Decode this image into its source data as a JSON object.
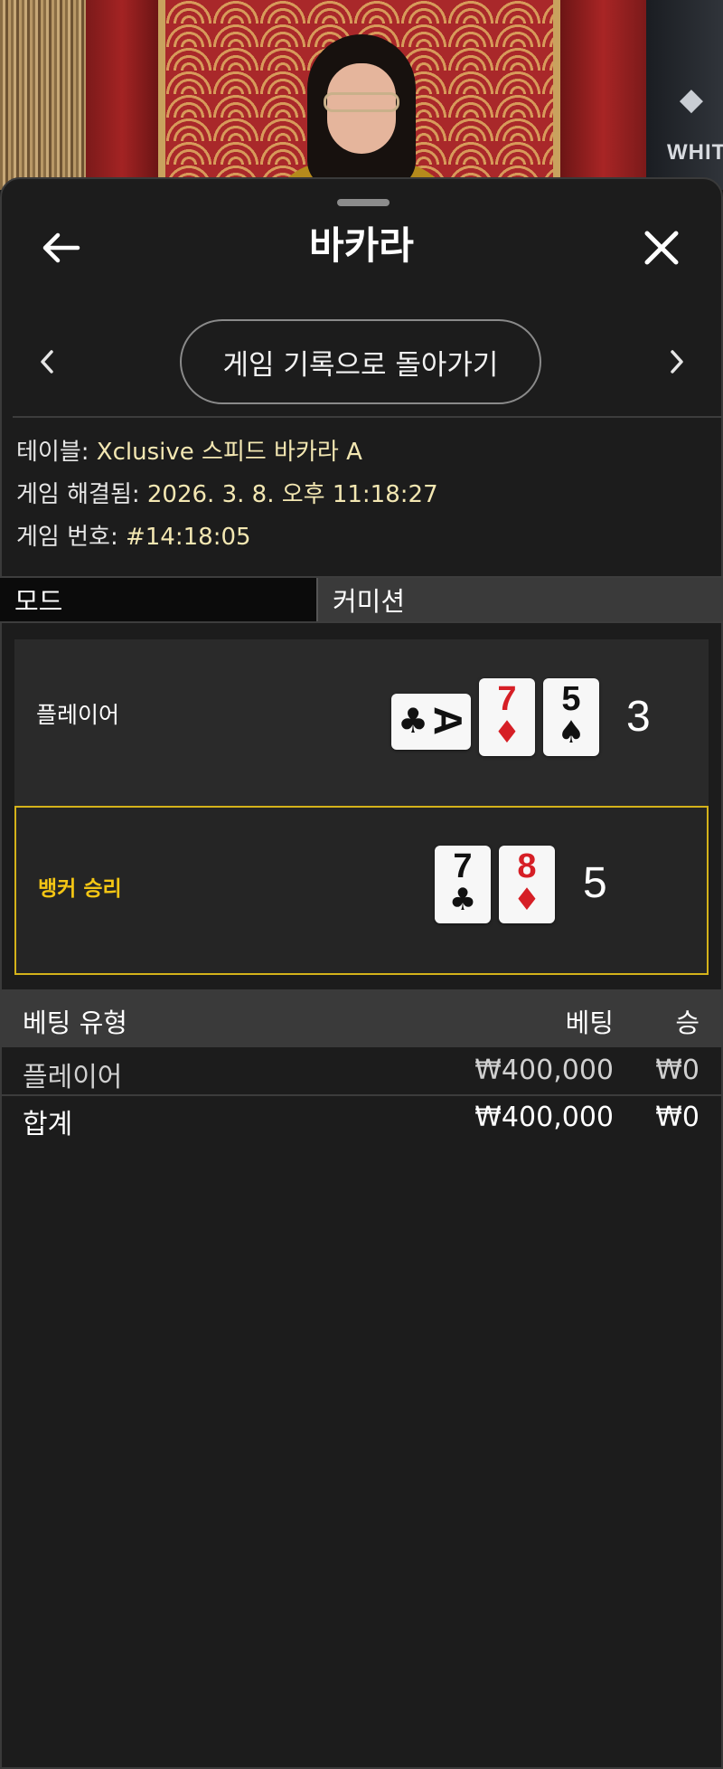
{
  "backdrop": {
    "brand_text": "WHIT"
  },
  "header": {
    "title": "바카라"
  },
  "nav": {
    "history_label": "게임 기록으로 돌아가기"
  },
  "info": {
    "table_label": "테이블:",
    "table_value": "Xclusive 스피드 바카라 A",
    "resolved_label": "게임 해결됨:",
    "resolved_value": "2026. 3. 8. 오후 11:18:27",
    "number_label": "게임 번호:",
    "number_value": "#14:18:05"
  },
  "tabs": [
    {
      "label": "모드",
      "active": true
    },
    {
      "label": "커미션",
      "active": false
    }
  ],
  "result": {
    "player": {
      "label": "플레이어",
      "score": "3",
      "cards": [
        {
          "rank": "A",
          "suit": "♣",
          "color": "black",
          "orientation": "sideways"
        },
        {
          "rank": "7",
          "suit": "♦",
          "color": "red"
        },
        {
          "rank": "5",
          "suit": "♠",
          "color": "black"
        }
      ]
    },
    "banker": {
      "label": "뱅커 승리",
      "score": "5",
      "cards": [
        {
          "rank": "7",
          "suit": "♣",
          "color": "black"
        },
        {
          "rank": "8",
          "suit": "♦",
          "color": "red"
        }
      ]
    }
  },
  "bets": {
    "headers": {
      "type": "베팅 유형",
      "bet": "베팅",
      "win": "승"
    },
    "rows": [
      {
        "type": "플레이어",
        "bet": "₩400,000",
        "win": "₩0"
      }
    ],
    "total": {
      "type": "합계",
      "bet": "₩400,000",
      "win": "₩0"
    }
  },
  "colors": {
    "background": "#1c1c1c",
    "accent_gold": "#f4c614",
    "info_value": "#f3e7b2",
    "card_red": "#d61f26"
  },
  "icons": {
    "back": "arrow-left-icon",
    "close": "close-icon",
    "prev": "chevron-left-icon",
    "next": "chevron-right-icon"
  }
}
